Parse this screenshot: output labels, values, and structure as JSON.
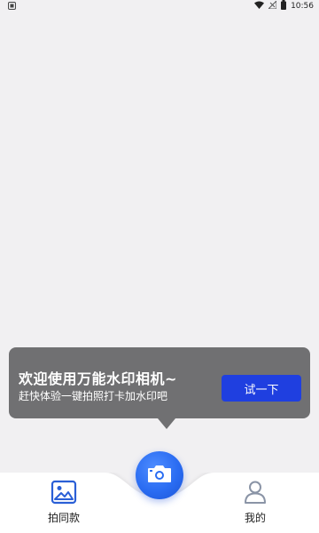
{
  "status_bar": {
    "time": "10:56",
    "icons": [
      "wifi-icon",
      "signal-icon",
      "battery-icon"
    ]
  },
  "tooltip": {
    "title": "欢迎使用万能水印相机~",
    "subtitle": "赶快体验一键拍照打卡加水印吧",
    "button_label": "试一下"
  },
  "bottom_nav": {
    "left": {
      "label": "拍同款",
      "icon": "image-icon"
    },
    "center": {
      "icon": "camera-icon"
    },
    "right": {
      "label": "我的",
      "icon": "person-icon"
    }
  },
  "colors": {
    "background": "#f1f0f2",
    "tooltip_bg": "#707072",
    "accent": "#1f3fe0",
    "camera_blue": "#2a6cf2"
  }
}
